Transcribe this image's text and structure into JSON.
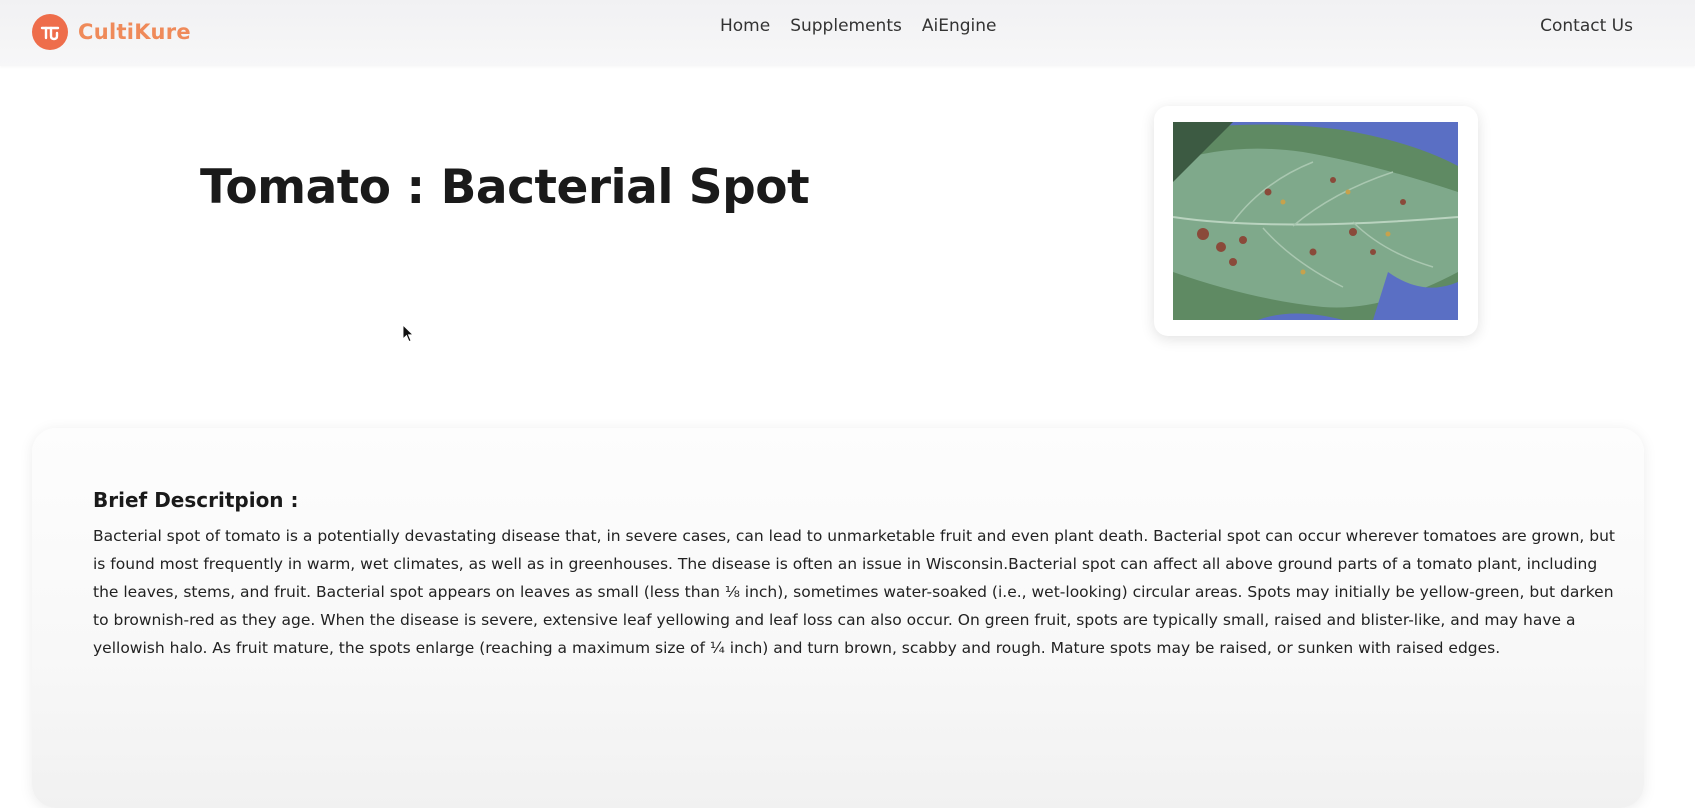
{
  "nav": {
    "brand": "CultiKure",
    "links": [
      "Home",
      "Supplements",
      "AiEngine"
    ],
    "contact": "Contact Us"
  },
  "page": {
    "title": "Tomato : Bacterial Spot"
  },
  "colors": {
    "brand_accent": "#ef8a5a",
    "logo_bg": "#ee6d4b"
  },
  "description": {
    "heading": "Brief Descritpion :",
    "body": "Bacterial spot of tomato is a potentially devastating disease that, in severe cases, can lead to unmarketable fruit and even plant death. Bacterial spot can occur wherever tomatoes are grown, but is found most frequently in warm, wet climates, as well as in greenhouses. The disease is often an issue in Wisconsin.Bacterial spot can affect all above ground parts of a tomato plant, including the leaves, stems, and fruit. Bacterial spot appears on leaves as small (less than ⅛ inch), sometimes water-soaked (i.e., wet-looking) circular areas. Spots may initially be yellow-green, but darken to brownish-red as they age. When the disease is severe, extensive leaf yellowing and leaf loss can also occur. On green fruit, spots are typically small, raised and blister-like, and may have a yellowish halo. As fruit mature, the spots enlarge (reaching a maximum size of ¼ inch) and turn brown, scabby and rough. Mature spots may be raised, or sunken with raised edges."
  }
}
